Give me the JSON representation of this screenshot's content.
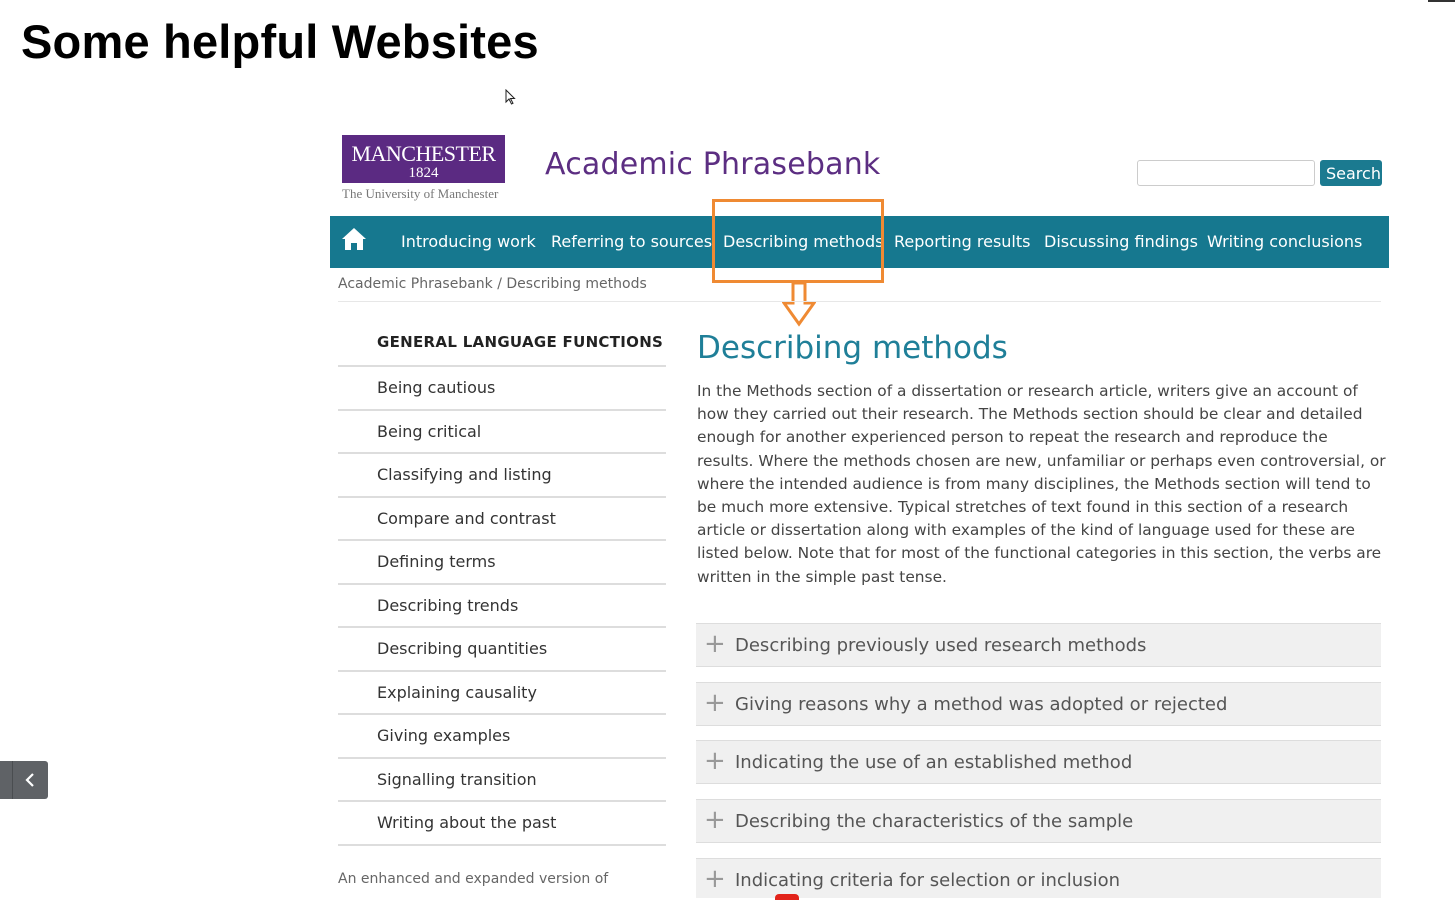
{
  "slide": {
    "title": "Some helpful Websites"
  },
  "site": {
    "logo_name": "MANCHESTER",
    "logo_year": "1824",
    "logo_subtitle": "The University of Manchester",
    "title": "Academic Phrasebank",
    "search": {
      "value": "",
      "button_label": "Search"
    }
  },
  "nav": {
    "home_icon": "home-icon",
    "items": [
      {
        "label": "Introducing work"
      },
      {
        "label": "Referring to sources"
      },
      {
        "label": "Describing methods",
        "highlighted": true
      },
      {
        "label": "Reporting results"
      },
      {
        "label": "Discussing findings"
      },
      {
        "label": "Writing conclusions"
      }
    ]
  },
  "breadcrumb": "Academic Phrasebank / Describing methods",
  "sidebar": {
    "heading": "GENERAL LANGUAGE FUNCTIONS",
    "items": [
      "Being cautious",
      "Being critical",
      "Classifying and listing",
      "Compare and contrast",
      "Defining terms",
      "Describing trends",
      "Describing quantities",
      "Explaining causality",
      "Giving examples",
      "Signalling transition",
      "Writing about the past"
    ],
    "footer": "An enhanced and expanded version of"
  },
  "content": {
    "title": "Describing methods",
    "body": "In the Methods section of a dissertation or research article, writers give an account of how they carried out their research. The Methods section should be clear and detailed enough for another experienced person to repeat the research and reproduce the results. Where the methods chosen are new, unfamiliar or perhaps even controversial, or where the intended audience is from many disciplines, the Methods section will tend to be much more extensive. Typical stretches of text found in this section of a research article or dissertation along with examples of the kind of language used for these are listed below. Note that for most of the functional categories in this section, the verbs are written in the simple past tense.",
    "accordion": [
      "Describing previously used research methods",
      "Giving reasons why a method was adopted or rejected",
      "Indicating the use of an established method",
      "Describing the characteristics of the sample",
      "Indicating criteria for selection or inclusion"
    ]
  },
  "colors": {
    "nav": "#16788f",
    "brand_purple": "#5c2e82",
    "highlight": "#ef8a33",
    "heading_teal": "#1f7f98"
  }
}
